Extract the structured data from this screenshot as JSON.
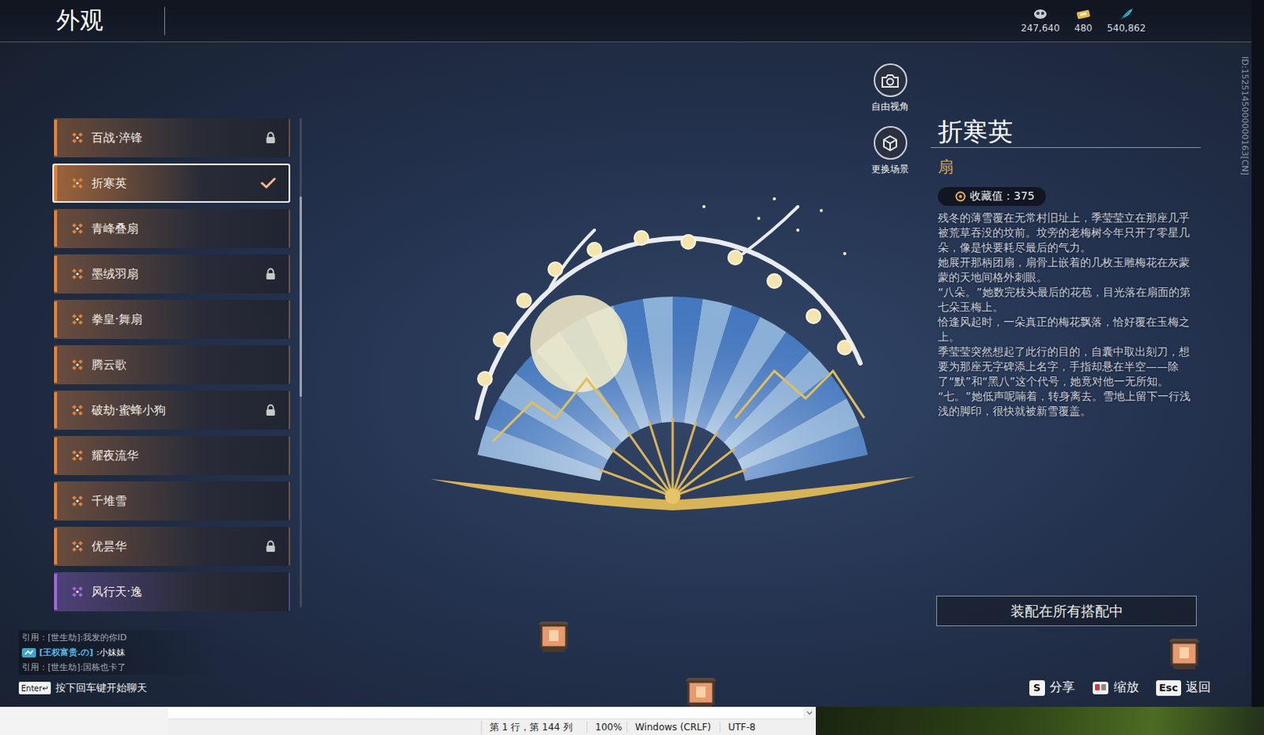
{
  "window": {
    "title": "外观"
  },
  "currencies": [
    {
      "value": "247,640",
      "kind": "mask"
    },
    {
      "value": "480",
      "kind": "ticket"
    },
    {
      "value": "540,862",
      "kind": "feather"
    }
  ],
  "account_id": "ID:1525145000000163[CN]",
  "sidebar": {
    "items": [
      {
        "name": "百战·淬锋",
        "locked": true,
        "selected": false,
        "color": "#e0833a"
      },
      {
        "name": "折寒英",
        "locked": false,
        "selected": true,
        "color": "#e0833a"
      },
      {
        "name": "青峰叠扇",
        "locked": false,
        "selected": false,
        "color": "#e0833a"
      },
      {
        "name": "墨绒羽扇",
        "locked": true,
        "selected": false,
        "color": "#e0833a"
      },
      {
        "name": "拳皇·舞扇",
        "locked": false,
        "selected": false,
        "color": "#e0833a"
      },
      {
        "name": "腾云歌",
        "locked": false,
        "selected": false,
        "color": "#e0833a"
      },
      {
        "name": "破劫·蜜蜂小狗",
        "locked": true,
        "selected": false,
        "color": "#e0833a"
      },
      {
        "name": "耀夜流华",
        "locked": false,
        "selected": false,
        "color": "#e0833a"
      },
      {
        "name": "千堆雪",
        "locked": false,
        "selected": false,
        "color": "#e0833a"
      },
      {
        "name": "优昙华",
        "locked": true,
        "selected": false,
        "color": "#e0833a"
      },
      {
        "name": "风行天·逸",
        "locked": false,
        "selected": false,
        "color": "#9b6ad6"
      }
    ],
    "scrollbar": {
      "offset": 0.16,
      "level": 0.41
    }
  },
  "view_controls": [
    {
      "label": "自由视角",
      "kind": "camera"
    },
    {
      "label": "更换场景",
      "kind": "scene"
    }
  ],
  "detail": {
    "name": "折寒英",
    "type": "扇",
    "collection": {
      "label": "收藏值：",
      "value": "375"
    },
    "description": [
      "残冬的薄雪覆在无常村旧址上，季莹莹立在那座几乎被荒草吞没的坟前。坟旁的老梅树今年只开了零星几朵，像是快要耗尽最后的气力。",
      "她展开那柄团扇，扇骨上嵌着的几枚玉雕梅花在灰蒙蒙的天地间格外刺眼。",
      "“八朵。”她数完枝头最后的花苞，目光落在扇面的第七朵玉梅上。",
      "恰逢风起时，一朵真正的梅花飘落，恰好覆在玉梅之上。",
      "季莹莹突然想起了此行的目的，自囊中取出刻刀，想要为那座无字碑添上名字，手指却悬在半空——除了“默”和“黑八”这个代号，她竟对他一无所知。",
      "“七。”她低声呢喃着，转身离去。雪地上留下一行浅浅的脚印，很快就被新雪覆盖。"
    ],
    "equip_button": "装配在所有搭配中"
  },
  "chat": {
    "lines": [
      {
        "kind": "quote",
        "text": "引用：[世生劫]:我发的你ID"
      },
      {
        "kind": "message",
        "channel": "[王权富贵.の]",
        "text": ":小妹妹"
      },
      {
        "kind": "quote",
        "text": "引用：[世生劫]:国栋也卡了"
      }
    ],
    "hint_key": "Enter↵",
    "hint": "按下回车键开始聊天"
  },
  "hotkeys": [
    {
      "kind": "key",
      "key": "S",
      "label": "分享"
    },
    {
      "kind": "mouse",
      "label": "缩放"
    },
    {
      "kind": "key",
      "key": "Esc",
      "label": "返回"
    }
  ],
  "editor_status": [
    "第 1 行，第 144 列",
    "100%",
    "Windows (CRLF)",
    "UTF-8"
  ]
}
